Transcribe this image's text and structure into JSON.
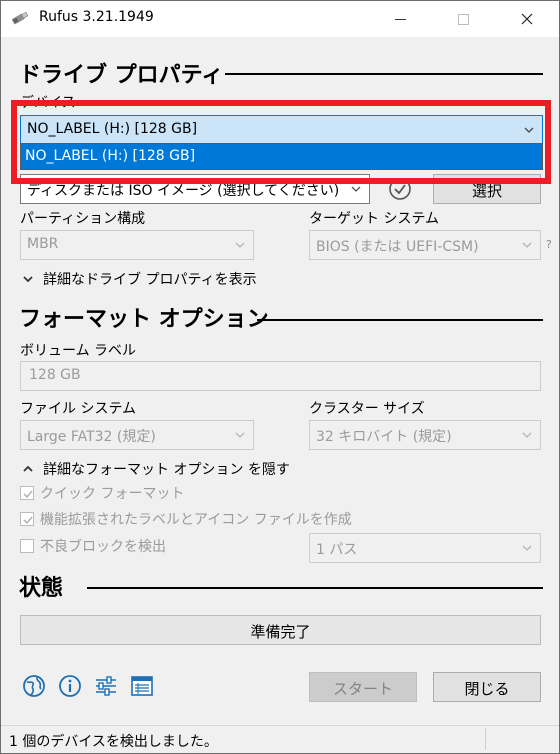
{
  "window": {
    "title": "Rufus 3.21.1949",
    "accent_color": "#0078d7",
    "highlight_color": "#ee1c25"
  },
  "drive_properties": {
    "header": "ドライブ プロパティ",
    "device_label": "デバイス",
    "device_value": "NO_LABEL (H:) [128 GB]",
    "device_dropdown_options": [
      "NO_LABEL (H:) [128 GB]"
    ],
    "boot_selection_value": "ディスクまたは ISO イメージ (選択してください)",
    "select_button": "選択",
    "partition_label": "パーティション構成",
    "partition_value": "MBR",
    "target_label": "ターゲット システム",
    "target_value": "BIOS (または UEFI-CSM)",
    "help_mark": "?",
    "advanced_toggle": "詳細なドライブ プロパティを表示"
  },
  "format_options": {
    "header": "フォーマット オプション",
    "volume_label_label": "ボリューム ラベル",
    "volume_label_value": "128 GB",
    "filesystem_label": "ファイル システム",
    "filesystem_value": "Large FAT32 (規定)",
    "cluster_label": "クラスター サイズ",
    "cluster_value": "32 キロバイト (規定)",
    "advanced_toggle": "詳細なフォーマット オプション を隠す",
    "quick_format": "クイック フォーマット",
    "extended_label": "機能拡張されたラベルとアイコン ファイルを作成",
    "bad_blocks": "不良ブロックを検出",
    "passes_value": "1 パス"
  },
  "status": {
    "header": "状態",
    "progress_text": "準備完了"
  },
  "actions": {
    "start_button": "スタート",
    "close_button": "閉じる"
  },
  "statusbar": {
    "text": "1 個のデバイスを検出しました。"
  },
  "icons": {
    "language": "globe-icon",
    "about": "info-icon",
    "settings": "sliders-icon",
    "log": "log-icon"
  }
}
